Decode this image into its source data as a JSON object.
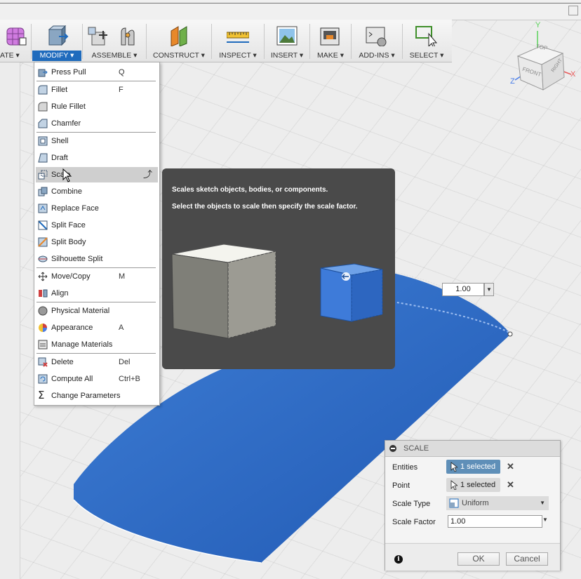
{
  "toolbar": {
    "groups": [
      {
        "label": "ATE ▾"
      },
      {
        "label": "MODIFY ▾"
      },
      {
        "label": "ASSEMBLE ▾"
      },
      {
        "label": "CONSTRUCT ▾"
      },
      {
        "label": "INSPECT ▾"
      },
      {
        "label": "INSERT ▾"
      },
      {
        "label": "MAKE ▾"
      },
      {
        "label": "ADD-INS ▾"
      },
      {
        "label": "SELECT ▾"
      }
    ]
  },
  "modify_menu": {
    "items": [
      {
        "label": "Press Pull",
        "shortcut": "Q"
      },
      {
        "label": "Fillet",
        "shortcut": "F"
      },
      {
        "label": "Rule Fillet",
        "shortcut": ""
      },
      {
        "label": "Chamfer",
        "shortcut": ""
      },
      {
        "label": "Shell",
        "shortcut": ""
      },
      {
        "label": "Draft",
        "shortcut": ""
      },
      {
        "label": "Scale",
        "shortcut": ""
      },
      {
        "label": "Combine",
        "shortcut": ""
      },
      {
        "label": "Replace Face",
        "shortcut": ""
      },
      {
        "label": "Split Face",
        "shortcut": ""
      },
      {
        "label": "Split Body",
        "shortcut": ""
      },
      {
        "label": "Silhouette Split",
        "shortcut": ""
      },
      {
        "label": "Move/Copy",
        "shortcut": "M"
      },
      {
        "label": "Align",
        "shortcut": ""
      },
      {
        "label": "Physical Material",
        "shortcut": ""
      },
      {
        "label": "Appearance",
        "shortcut": "A"
      },
      {
        "label": "Manage Materials",
        "shortcut": ""
      },
      {
        "label": "Delete",
        "shortcut": "Del"
      },
      {
        "label": "Compute All",
        "shortcut": "Ctrl+B"
      },
      {
        "label": "Change Parameters",
        "shortcut": ""
      }
    ]
  },
  "tooltip": {
    "line1": "Scales sketch objects, bodies, or components.",
    "line2": "Select the objects to scale then specify the scale factor."
  },
  "viewport": {
    "scale_value": "1.00"
  },
  "view_cube": {
    "top": "TOP",
    "front": "FRONT",
    "right": "RIGHT",
    "axis_x": "X",
    "axis_y": "Y",
    "axis_z": "Z"
  },
  "scale_dialog": {
    "title": "SCALE",
    "entities_label": "Entities",
    "entities_value": "1 selected",
    "point_label": "Point",
    "point_value": "1 selected",
    "scale_type_label": "Scale Type",
    "scale_type_value": "Uniform",
    "scale_factor_label": "Scale Factor",
    "scale_factor_value": "1.00",
    "ok_label": "OK",
    "cancel_label": "Cancel"
  },
  "colors": {
    "accent": "#1f6bbd",
    "body_blue": "#2e6ac4",
    "tooltip_bg": "#4a4a4a"
  }
}
